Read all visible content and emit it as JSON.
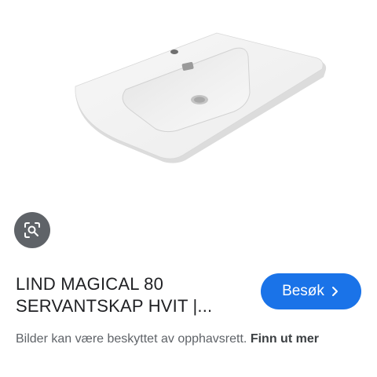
{
  "image": {
    "alt": "",
    "icon": "washbasin-product-image"
  },
  "lens": {
    "icon": "lens-search-icon",
    "color": "#5f6368"
  },
  "result": {
    "title_line1": "LIND MAGICAL 80",
    "title_line2": "SERVANTSKAP HVIT |..."
  },
  "visit_button": {
    "label": "Besøk",
    "icon": "chevron-right-icon",
    "color": "#1a73e8"
  },
  "disclaimer": {
    "text": "Bilder kan være beskyttet av opphavsrett.",
    "link": "Finn ut mer"
  }
}
